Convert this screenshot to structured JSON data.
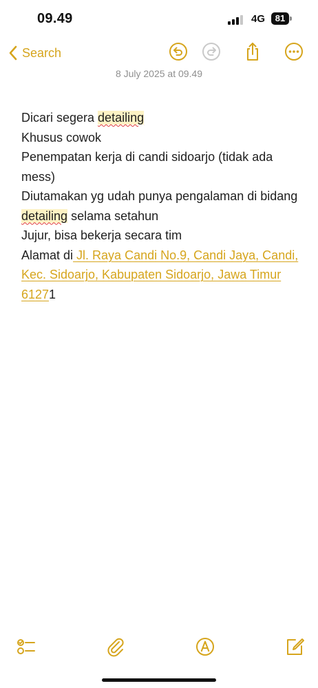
{
  "status": {
    "time": "09.49",
    "network": "4G",
    "battery": "81"
  },
  "nav": {
    "back_label": "Search"
  },
  "note": {
    "date": "8 July 2025 at 09.49",
    "line1_prefix": "Dicari segera ",
    "line1_word": "detailing",
    "line2": "Khusus cowok",
    "line3": "Penempatan kerja di candi sidoarjo (tidak ada mess)",
    "line4_prefix": "Diutamakan yg udah punya pengalaman di bidang ",
    "line4_word": "detailing",
    "line4_suffix": " selama setahun",
    "line5": "Jujur, bisa bekerja secara tim",
    "line6_prefix": "Alamat di",
    "address": " Jl. Raya Candi No.9, Candi Jaya, Candi, Kec. Sidoarjo, Kabupaten Sidoarjo, Jawa Timur 6127",
    "address_tail": "1"
  },
  "colors": {
    "accent": "#d6a51d",
    "text": "#1f1f1f",
    "date": "#8f8f8f",
    "highlight": "#fdf2c4",
    "spellcheck": "#e03a3a"
  }
}
